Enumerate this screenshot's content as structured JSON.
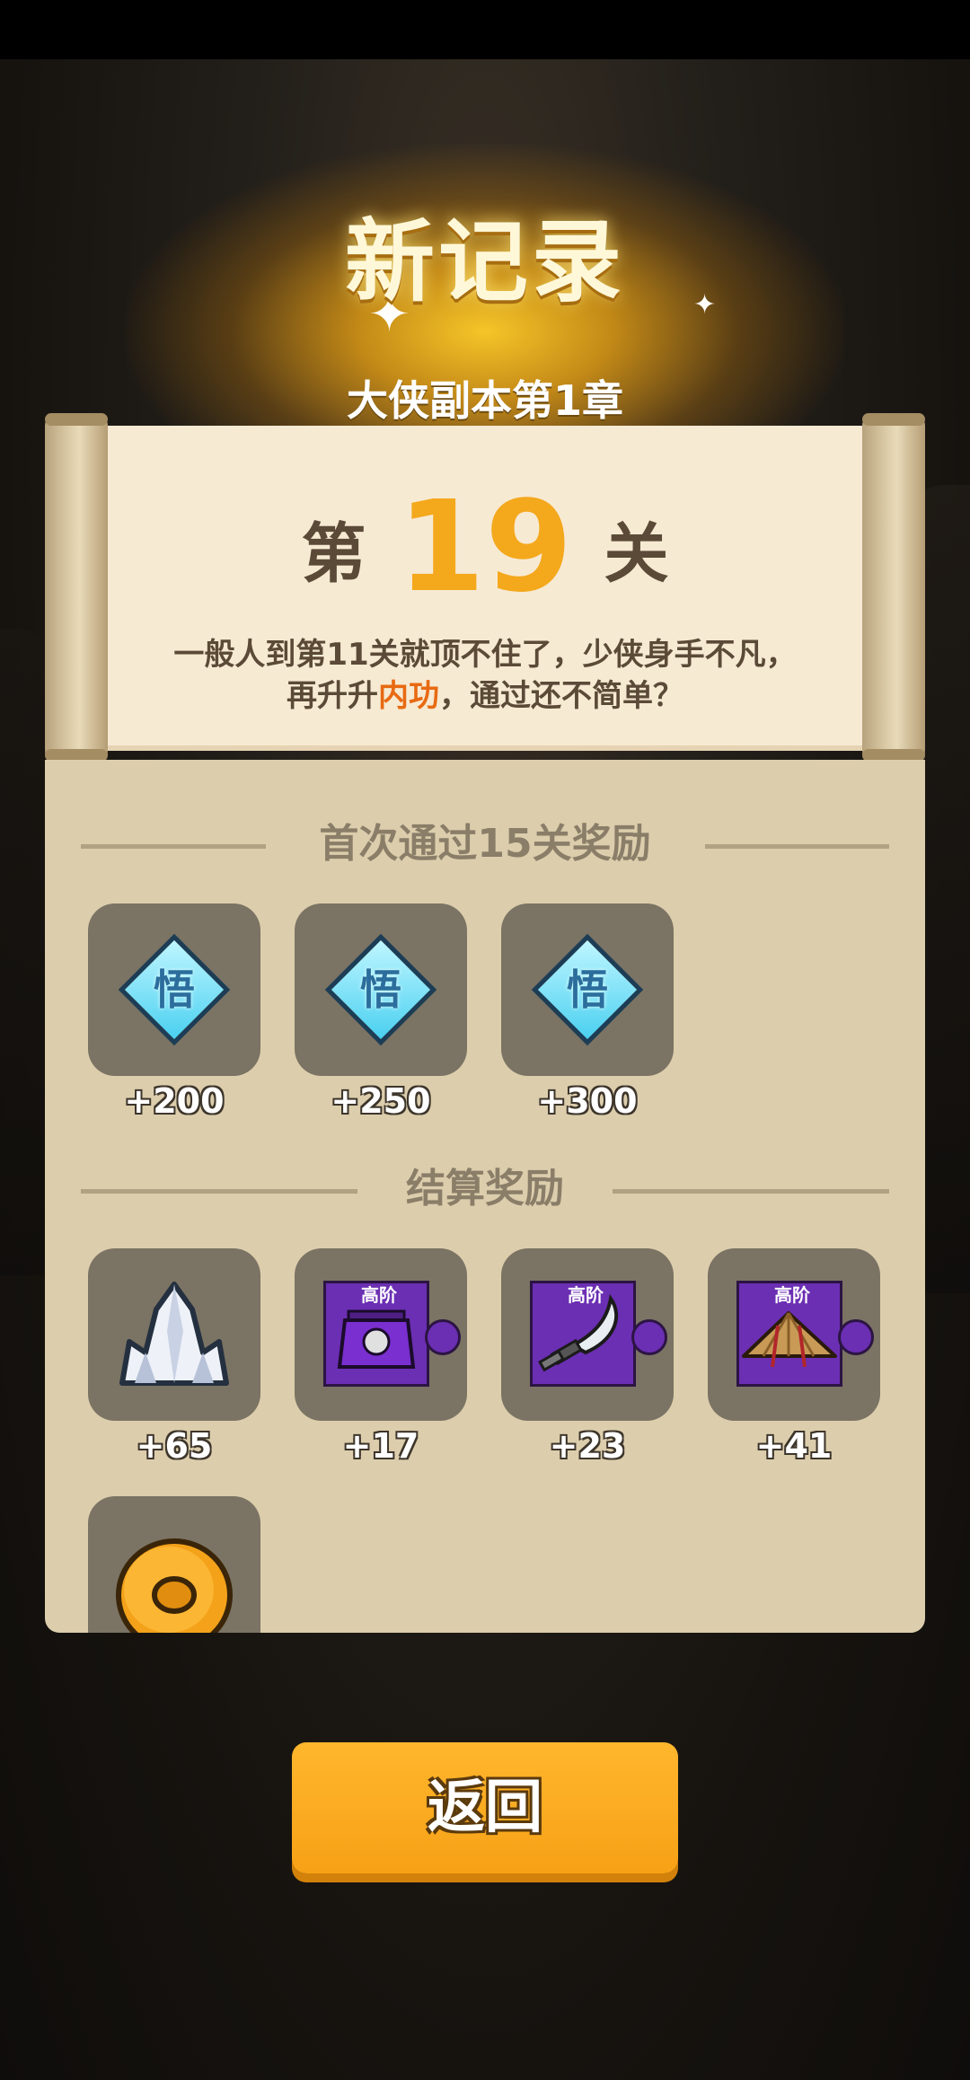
{
  "header": {
    "title": "新记录",
    "chapter": "大侠副本第1章"
  },
  "scroll": {
    "level_prefix": "第",
    "level_number": "19",
    "level_suffix": "关",
    "desc_line1": "一般人到第11关就顶不住了，少侠身手不凡，",
    "desc_line2_pre": "再升升",
    "desc_line2_highlight": "内功",
    "desc_line2_post": "，通过还不简单？"
  },
  "first_clear": {
    "title": "首次通过15关奖励",
    "items": [
      {
        "icon": "wisdom-diamond-icon",
        "glyph": "悟",
        "amount": "+200"
      },
      {
        "icon": "wisdom-diamond-icon",
        "glyph": "悟",
        "amount": "+250"
      },
      {
        "icon": "wisdom-diamond-icon",
        "glyph": "悟",
        "amount": "+300"
      }
    ]
  },
  "settlement": {
    "title": "结算奖励",
    "items": [
      {
        "icon": "crystal-icon",
        "amount": "+65"
      },
      {
        "icon": "armor-fragment-icon",
        "badge": "高阶",
        "amount": "+17"
      },
      {
        "icon": "saber-fragment-icon",
        "badge": "高阶",
        "amount": "+23"
      },
      {
        "icon": "hat-fragment-icon",
        "badge": "高阶",
        "amount": "+41"
      },
      {
        "icon": "coin-icon",
        "amount": ""
      }
    ]
  },
  "colors": {
    "accent": "#f4a81c",
    "highlight": "#e86a12",
    "panel": "#dccdac",
    "tile": "#7b7363"
  },
  "back_button": {
    "label": "返回"
  }
}
